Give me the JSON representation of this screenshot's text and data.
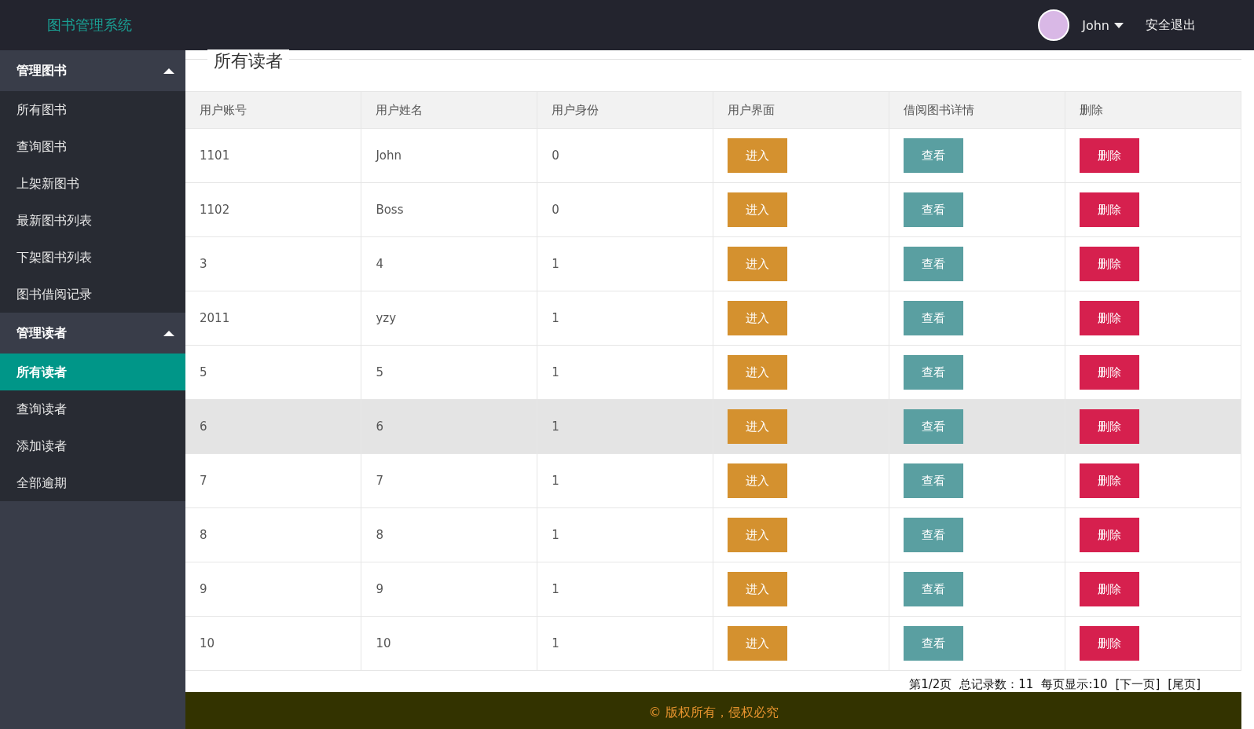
{
  "header": {
    "logo": "图书管理系统",
    "user": {
      "name": "John"
    },
    "logout": "安全退出"
  },
  "sidebar": {
    "groups": [
      {
        "title": "管理图书",
        "expanded": true,
        "items": [
          {
            "label": "所有图书",
            "selected": false
          },
          {
            "label": "查询图书",
            "selected": false
          },
          {
            "label": "上架新图书",
            "selected": false
          },
          {
            "label": "最新图书列表",
            "selected": false
          },
          {
            "label": "下架图书列表",
            "selected": false
          },
          {
            "label": "图书借阅记录",
            "selected": false
          }
        ]
      },
      {
        "title": "管理读者",
        "expanded": true,
        "items": [
          {
            "label": "所有读者",
            "selected": true
          },
          {
            "label": "查询读者",
            "selected": false
          },
          {
            "label": "添加读者",
            "selected": false
          },
          {
            "label": "全部逾期",
            "selected": false
          }
        ]
      }
    ]
  },
  "page_title": "所有读者",
  "table": {
    "columns": [
      "用户账号",
      "用户姓名",
      "用户身份",
      "用户界面",
      "借阅图书详情",
      "删除"
    ],
    "rows": [
      {
        "cells": [
          "1101",
          "John",
          "0"
        ],
        "buttons": [
          "进入",
          "查看",
          "删除"
        ],
        "selected": false
      },
      {
        "cells": [
          "1102",
          "Boss",
          "0"
        ],
        "buttons": [
          "进入",
          "查看",
          "删除"
        ],
        "selected": false
      },
      {
        "cells": [
          "3",
          "4",
          "1"
        ],
        "buttons": [
          "进入",
          "查看",
          "删除"
        ],
        "selected": false
      },
      {
        "cells": [
          "2011",
          "yzy",
          "1"
        ],
        "buttons": [
          "进入",
          "查看",
          "删除"
        ],
        "selected": false
      },
      {
        "cells": [
          "5",
          "5",
          "1"
        ],
        "buttons": [
          "进入",
          "查看",
          "删除"
        ],
        "selected": false
      },
      {
        "cells": [
          "6",
          "6",
          "1"
        ],
        "buttons": [
          "进入",
          "查看",
          "删除"
        ],
        "selected": true
      },
      {
        "cells": [
          "7",
          "7",
          "1"
        ],
        "buttons": [
          "进入",
          "查看",
          "删除"
        ],
        "selected": false
      },
      {
        "cells": [
          "8",
          "8",
          "1"
        ],
        "buttons": [
          "进入",
          "查看",
          "删除"
        ],
        "selected": false
      },
      {
        "cells": [
          "9",
          "9",
          "1"
        ],
        "buttons": [
          "进入",
          "查看",
          "删除"
        ],
        "selected": false
      },
      {
        "cells": [
          "10",
          "10",
          "1"
        ],
        "buttons": [
          "进入",
          "查看",
          "删除"
        ],
        "selected": false
      }
    ]
  },
  "pagination": {
    "page": "第1/2页",
    "total": "总记录数：11",
    "per_page": "每页显示:10",
    "next": "[下一页]",
    "last": "[尾页]"
  },
  "footer": "© 版权所有，侵权必究"
}
